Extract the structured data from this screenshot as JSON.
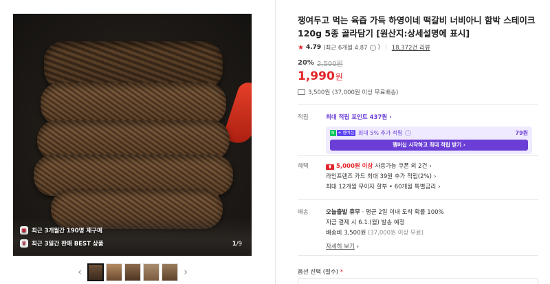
{
  "gallery": {
    "badges": [
      {
        "icon": "bag-icon",
        "text": "최근 3개월간 190명 재구매"
      },
      {
        "icon": "trophy-icon",
        "text": "최근 3일간 판매 BEST 상품"
      }
    ],
    "counter_current": "1",
    "counter_total": "/9",
    "prev_arrow": "‹",
    "next_arrow": "›",
    "thumbnail_count": 5
  },
  "product": {
    "title": "쟁여두고 먹는 육즙 가득 하영이네 떡갈비 너비아니 함박 스테이크 120g 5종 골라담기 [원산지:상세설명에 표시]",
    "rating": "4.79",
    "rating_recent": "(최근 6개월 4.87",
    "rating_recent_close": ")",
    "review_count": "18,372건 리뷰",
    "discount_rate": "20%",
    "original_price": "2,500원",
    "sale_price": "1,990",
    "sale_currency": "원",
    "shipping_summary": "3,500원 (37,000원 이상 무료배송)"
  },
  "points": {
    "label": "적립",
    "max_points": "최대 적립 포인트 437원",
    "membership_extra": "최대 5% 추가 적립",
    "membership_amount": "79원",
    "membership_button": "멤버십 시작하고 최대 적립 받기",
    "logo_n": "N",
    "logo_plus": "+ 멤버십"
  },
  "benefits": {
    "label": "혜택",
    "coupon_amount": "5,000원 이상",
    "coupon_text": "사용가능 쿠폰 외 2건",
    "line_card": "라인프렌즈 카드 최대 39원 추가 적립(2%)",
    "installment": "최대 12개월 무이자 할부 • 60개월 특별금리"
  },
  "delivery": {
    "label": "배송",
    "today": "오늘출발 휴무",
    "today_detail": "· 평균 2일 이내 도착 확률 100%",
    "schedule": "지금 결제 시 6.1.(월) 발송 예정",
    "fee": "배송비 3,500원",
    "fee_detail": "(37,000원 이상 무료)",
    "more": "자세히 보기"
  },
  "options": {
    "label": "옵션 선택",
    "required": "(필수)",
    "required_mark": "*"
  }
}
